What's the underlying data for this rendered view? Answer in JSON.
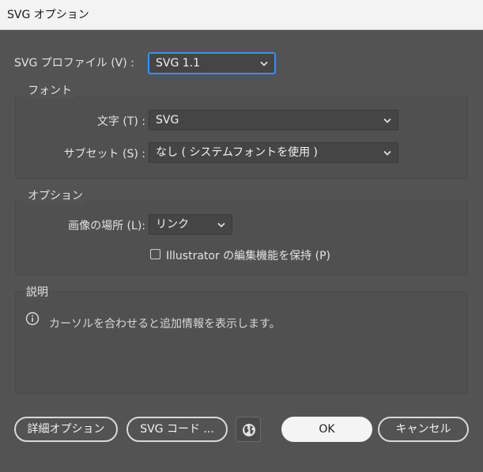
{
  "window": {
    "title": "SVG オプション"
  },
  "profile": {
    "label": "SVG プロファイル (V) :",
    "value": "SVG 1.1"
  },
  "font_group": {
    "title": "フォント",
    "type_label": "文字 (T) :",
    "type_value": "SVG",
    "subset_label": "サブセット (S) :",
    "subset_value": "なし ( システムフォントを使用 )"
  },
  "options_group": {
    "title": "オプション",
    "image_location_label": "画像の場所 (L):",
    "image_location_value": "リンク",
    "preserve_label": "Illustrator の編集機能を保持 (P)",
    "preserve_checked": false
  },
  "description_group": {
    "title": "説明",
    "text": "カーソルを合わせると追加情報を表示します。"
  },
  "buttons": {
    "advanced": "詳細オプション",
    "svg_code": "SVG コード ...",
    "ok": "OK",
    "cancel": "キャンセル"
  },
  "colors": {
    "focus": "#3b8ff0",
    "background": "#535353"
  }
}
